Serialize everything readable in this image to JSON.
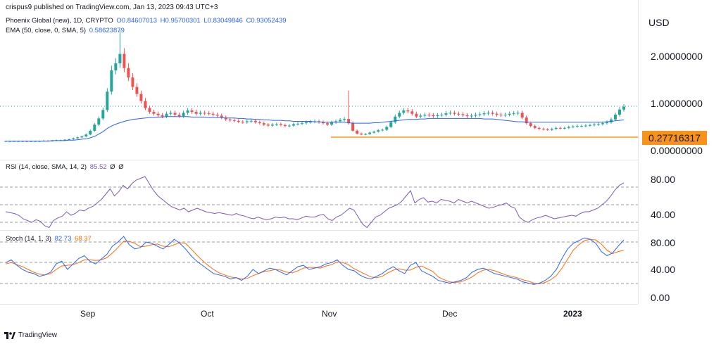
{
  "header": {
    "publisher_line": "crispus9 published on TradingView.com, Jan 13, 2023 09:43 UTC+3"
  },
  "legend_main": {
    "symbol": "Phoenix Global (new), 1D, CRYPTO",
    "open": "O0.84607013",
    "high": "H0.95700301",
    "low": "L0.83049846",
    "close": "C0.93052439",
    "ema_label": "EMA (50, close, 0, SMA, 5)",
    "ema_value": "0.58623879"
  },
  "legend_rsi": {
    "label": "RSI (14, close, SMA, 14, 2)",
    "value": "85.52",
    "extra1": "Ø",
    "extra2": "Ø"
  },
  "legend_stoch": {
    "label": "Stoch (14, 1, 3)",
    "k_value": "82.73",
    "d_value": "68.37"
  },
  "price_axis": {
    "currency": "USD",
    "tick_2": "2.00000000",
    "tick_1": "1.00000000",
    "tick_0": "0.00000000",
    "support_label": "0.27716317"
  },
  "rsi_axis": {
    "tick_80": "80.00",
    "tick_40": "40.00"
  },
  "stoch_axis": {
    "tick_80": "80.00",
    "tick_40": "40.00",
    "tick_0": "0.00"
  },
  "time_axis": {
    "m1": "Sep",
    "m2": "Oct",
    "m3": "Nov",
    "m4": "Dec",
    "m5": "2023"
  },
  "footer": {
    "brand": "TradingView"
  },
  "colors": {
    "up": "#26a69a",
    "down": "#ef5350",
    "ema": "#2962ff",
    "rsi": "#7e57c2",
    "stoch_k": "#2962ff",
    "stoch_d": "#ff6d00",
    "support": "#f7931a"
  },
  "chart_data": {
    "type": "candlestick",
    "title": "Phoenix Global (new), 1D, CRYPTO",
    "x_axis_labels": [
      "Sep",
      "Oct",
      "Nov",
      "Dec",
      "2023"
    ],
    "y_axis": {
      "unit": "USD",
      "ticks": [
        0,
        1,
        2
      ]
    },
    "support_level": 0.27716317,
    "close_series": [
      0.2,
      0.2,
      0.2,
      0.2,
      0.2,
      0.19,
      0.2,
      0.2,
      0.2,
      0.21,
      0.2,
      0.21,
      0.22,
      0.22,
      0.23,
      0.24,
      0.26,
      0.28,
      0.3,
      0.34,
      0.42,
      0.55,
      0.68,
      0.86,
      1.25,
      1.7,
      1.85,
      2.05,
      1.75,
      1.55,
      1.35,
      1.2,
      1.05,
      0.9,
      0.82,
      0.78,
      0.75,
      0.72,
      0.78,
      0.8,
      0.76,
      0.73,
      0.8,
      0.85,
      0.82,
      0.78,
      0.8,
      0.79,
      0.78,
      0.76,
      0.74,
      0.7,
      0.66,
      0.64,
      0.63,
      0.61,
      0.6,
      0.62,
      0.63,
      0.6,
      0.58,
      0.55,
      0.53,
      0.55,
      0.56,
      0.54,
      0.52,
      0.53,
      0.56,
      0.57,
      0.58,
      0.6,
      0.61,
      0.62,
      0.6,
      0.58,
      0.55,
      0.6,
      0.62,
      0.65,
      0.67,
      0.58,
      0.42,
      0.36,
      0.34,
      0.35,
      0.38,
      0.4,
      0.43,
      0.44,
      0.5,
      0.6,
      0.72,
      0.8,
      0.85,
      0.83,
      0.78,
      0.72,
      0.74,
      0.76,
      0.75,
      0.73,
      0.75,
      0.76,
      0.79,
      0.8,
      0.78,
      0.77,
      0.75,
      0.73,
      0.74,
      0.76,
      0.77,
      0.79,
      0.8,
      0.78,
      0.76,
      0.75,
      0.76,
      0.78,
      0.79,
      0.8,
      0.7,
      0.58,
      0.52,
      0.48,
      0.46,
      0.45,
      0.44,
      0.46,
      0.48,
      0.47,
      0.48,
      0.5,
      0.51,
      0.52,
      0.52,
      0.53,
      0.54,
      0.55,
      0.56,
      0.58,
      0.6,
      0.66,
      0.76,
      0.87,
      0.93
    ],
    "ema50_series": [
      0.2,
      0.2,
      0.2,
      0.2,
      0.2,
      0.2,
      0.2,
      0.2,
      0.2,
      0.2,
      0.2,
      0.21,
      0.21,
      0.21,
      0.21,
      0.22,
      0.22,
      0.23,
      0.24,
      0.25,
      0.27,
      0.3,
      0.35,
      0.4,
      0.47,
      0.52,
      0.56,
      0.59,
      0.62,
      0.64,
      0.66,
      0.67,
      0.68,
      0.69,
      0.7,
      0.7,
      0.71,
      0.71,
      0.72,
      0.72,
      0.72,
      0.72,
      0.72,
      0.72,
      0.71,
      0.71,
      0.71,
      0.71,
      0.7,
      0.7,
      0.7,
      0.7,
      0.69,
      0.69,
      0.69,
      0.68,
      0.68,
      0.67,
      0.67,
      0.66,
      0.66,
      0.65,
      0.65,
      0.64,
      0.64,
      0.64,
      0.63,
      0.63,
      0.62,
      0.62,
      0.62,
      0.62,
      0.62,
      0.61,
      0.61,
      0.6,
      0.6,
      0.6,
      0.6,
      0.6,
      0.6,
      0.59,
      0.58,
      0.58,
      0.58,
      0.58,
      0.58,
      0.59,
      0.59,
      0.6,
      0.61,
      0.62,
      0.63,
      0.64,
      0.65,
      0.66,
      0.66,
      0.66,
      0.67,
      0.67,
      0.68,
      0.68,
      0.68,
      0.68,
      0.68,
      0.68,
      0.68,
      0.68,
      0.68,
      0.68,
      0.68,
      0.68,
      0.68,
      0.67,
      0.67,
      0.67,
      0.66,
      0.65,
      0.64,
      0.63,
      0.62,
      0.61,
      0.61,
      0.6,
      0.6,
      0.6,
      0.6,
      0.6,
      0.6,
      0.6,
      0.6,
      0.6,
      0.6,
      0.6,
      0.6,
      0.6,
      0.6,
      0.6,
      0.6,
      0.6,
      0.6,
      0.6,
      0.61,
      0.62,
      0.63,
      0.64,
      0.65
    ],
    "rsi_series": [
      52,
      51,
      50,
      48,
      44,
      42,
      40,
      43,
      41,
      36,
      34,
      42,
      45,
      47,
      52,
      48,
      50,
      54,
      53,
      56,
      58,
      62,
      66,
      72,
      78,
      70,
      75,
      82,
      78,
      84,
      88,
      90,
      92,
      84,
      76,
      70,
      66,
      62,
      58,
      56,
      54,
      56,
      52,
      54,
      56,
      54,
      52,
      51,
      50,
      51,
      50,
      49,
      48,
      50,
      48,
      47,
      45,
      44,
      46,
      44,
      43,
      44,
      46,
      45,
      46,
      44,
      44,
      43,
      45,
      47,
      46,
      46,
      48,
      49,
      44,
      42,
      46,
      48,
      52,
      56,
      54,
      46,
      38,
      34,
      40,
      46,
      48,
      52,
      56,
      58,
      60,
      64,
      70,
      76,
      62,
      66,
      68,
      63,
      64,
      62,
      66,
      65,
      64,
      62,
      66,
      64,
      62,
      64,
      62,
      60,
      58,
      56,
      57,
      59,
      60,
      62,
      58,
      56,
      46,
      42,
      40,
      43,
      45,
      46,
      48,
      46,
      44,
      45,
      46,
      47,
      48,
      47,
      50,
      52,
      52,
      54,
      56,
      60,
      64,
      70,
      77,
      82,
      85
    ],
    "stoch_k_series": [
      50,
      54,
      46,
      40,
      36,
      34,
      30,
      32,
      36,
      48,
      52,
      40,
      48,
      56,
      60,
      52,
      48,
      55,
      62,
      74,
      80,
      88,
      76,
      70,
      72,
      80,
      78,
      74,
      70,
      76,
      84,
      78,
      70,
      60,
      52,
      46,
      40,
      34,
      32,
      30,
      26,
      28,
      24,
      30,
      40,
      34,
      38,
      42,
      40,
      36,
      32,
      38,
      44,
      46,
      40,
      42,
      44,
      48,
      50,
      54,
      46,
      40,
      38,
      32,
      28,
      26,
      30,
      34,
      40,
      44,
      38,
      34,
      46,
      50,
      38,
      34,
      30,
      24,
      22,
      20,
      22,
      24,
      28,
      36,
      40,
      42,
      38,
      34,
      32,
      30,
      28,
      26,
      22,
      20,
      18,
      20,
      24,
      30,
      40,
      56,
      70,
      78,
      82,
      86,
      84,
      78,
      66,
      60,
      64,
      74,
      83
    ],
    "stoch_d_series": [
      48,
      50,
      47,
      44,
      40,
      36,
      33,
      32,
      34,
      40,
      45,
      46,
      47,
      50,
      54,
      54,
      53,
      54,
      57,
      64,
      72,
      81,
      81,
      78,
      73,
      74,
      76,
      77,
      74,
      73,
      76,
      79,
      78,
      70,
      61,
      53,
      46,
      40,
      35,
      32,
      29,
      28,
      26,
      27,
      31,
      34,
      37,
      38,
      40,
      39,
      36,
      35,
      38,
      42,
      43,
      43,
      42,
      45,
      47,
      51,
      50,
      47,
      41,
      37,
      33,
      29,
      28,
      30,
      35,
      39,
      41,
      39,
      39,
      43,
      45,
      41,
      37,
      29,
      25,
      22,
      21,
      22,
      25,
      29,
      35,
      39,
      40,
      38,
      35,
      32,
      30,
      28,
      25,
      23,
      20,
      19,
      21,
      25,
      31,
      42,
      55,
      68,
      76,
      82,
      84,
      83,
      77,
      68,
      63,
      66,
      68
    ]
  }
}
